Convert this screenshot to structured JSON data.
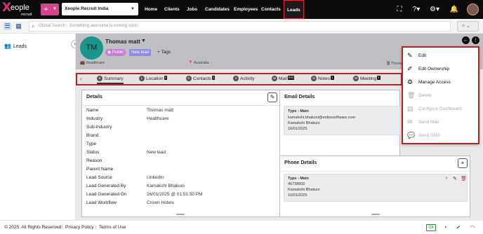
{
  "brand": {
    "logo_letter": "X",
    "logo_text": "eople",
    "logo_sub": "recruit",
    "accent": "#d6448b",
    "active_border": "#b8241c"
  },
  "topbar": {
    "add_label": "+",
    "org": "Xeople Recruit India",
    "nav": [
      "Home",
      "Clients",
      "Jobs",
      "Candidates",
      "Employees",
      "Contacts",
      "Leads"
    ],
    "active_nav": "Leads",
    "icons": [
      "fullscreen-icon",
      "help-icon",
      "settings-icon",
      "bell-icon",
      "user-avatar"
    ]
  },
  "search": {
    "placeholder": "Global Search - Something awesome is coming soon",
    "plus": "+"
  },
  "sidebar": {
    "items": [
      {
        "label": "Leads",
        "icon": "people-icon"
      }
    ]
  },
  "lead": {
    "initials": "TM",
    "name": "Thomas matt",
    "visibility": "Public",
    "status_badge": "New lead",
    "tags_label": "Tags",
    "industry": "Healthcare",
    "country": "Australia",
    "owner_short": "Thomas"
  },
  "tabs": [
    {
      "label": "Summary",
      "count": ""
    },
    {
      "label": "Location",
      "count": "1"
    },
    {
      "label": "Contacts",
      "count": "1"
    },
    {
      "label": "Activity",
      "count": ""
    },
    {
      "label": "Mail",
      "count": "644"
    },
    {
      "label": "Notes",
      "count": "1"
    },
    {
      "label": "Meeting",
      "count": "1"
    }
  ],
  "details": {
    "title": "Details",
    "rows": [
      {
        "label": "Name",
        "value": "Thomas matt"
      },
      {
        "label": "Industry",
        "value": "Healthcare"
      },
      {
        "label": "Sub-industry",
        "value": ""
      },
      {
        "label": "Brand",
        "value": ""
      },
      {
        "label": "Type",
        "value": ""
      },
      {
        "label": "Status",
        "value": "New lead"
      },
      {
        "label": "Reason",
        "value": ""
      },
      {
        "label": "Parent Name",
        "value": ""
      },
      {
        "label": "Lead Source",
        "value": "LinkedIn"
      },
      {
        "label": "Lead Generated By",
        "value": "Kamakshi Bhakuni"
      },
      {
        "label": "Lead Generated On",
        "value": "16/01/2025 @ 01:51:50 PM"
      },
      {
        "label": "Lead Workflow",
        "value": "Crown Hotels"
      }
    ]
  },
  "email": {
    "title": "Email Details",
    "type": "Type - Main",
    "address": "kamakshi.bhakuni@entiresoftware.com",
    "by": "Kamakshi Bhakuni",
    "date": "16/01/2025"
  },
  "phone": {
    "title": "Phone Details",
    "type": "Type - Main",
    "number": "46738902",
    "by": "Kamakshi Bhakuni",
    "date": "16/01/2025"
  },
  "menu": {
    "items": [
      {
        "label": "Edit",
        "enabled": true,
        "icon": "pencil-icon"
      },
      {
        "label": "Edit Ownership",
        "enabled": true,
        "icon": "pen-line-icon"
      },
      {
        "label": "Manage Access",
        "enabled": true,
        "icon": "gear-icon"
      },
      {
        "label": "Delete",
        "enabled": false,
        "icon": "trash-icon"
      },
      {
        "label": "Configure Dashboard",
        "enabled": false,
        "icon": "dashboard-icon"
      },
      {
        "label": "Send Mail",
        "enabled": false,
        "icon": "mail-icon"
      },
      {
        "label": "Send SMS",
        "enabled": false,
        "icon": "sms-icon"
      }
    ]
  },
  "footer": {
    "copyright": "© 2025. All Rights Reserved",
    "privacy": "Privacy Policy",
    "terms": "Terms of Use",
    "qa": "QA"
  }
}
